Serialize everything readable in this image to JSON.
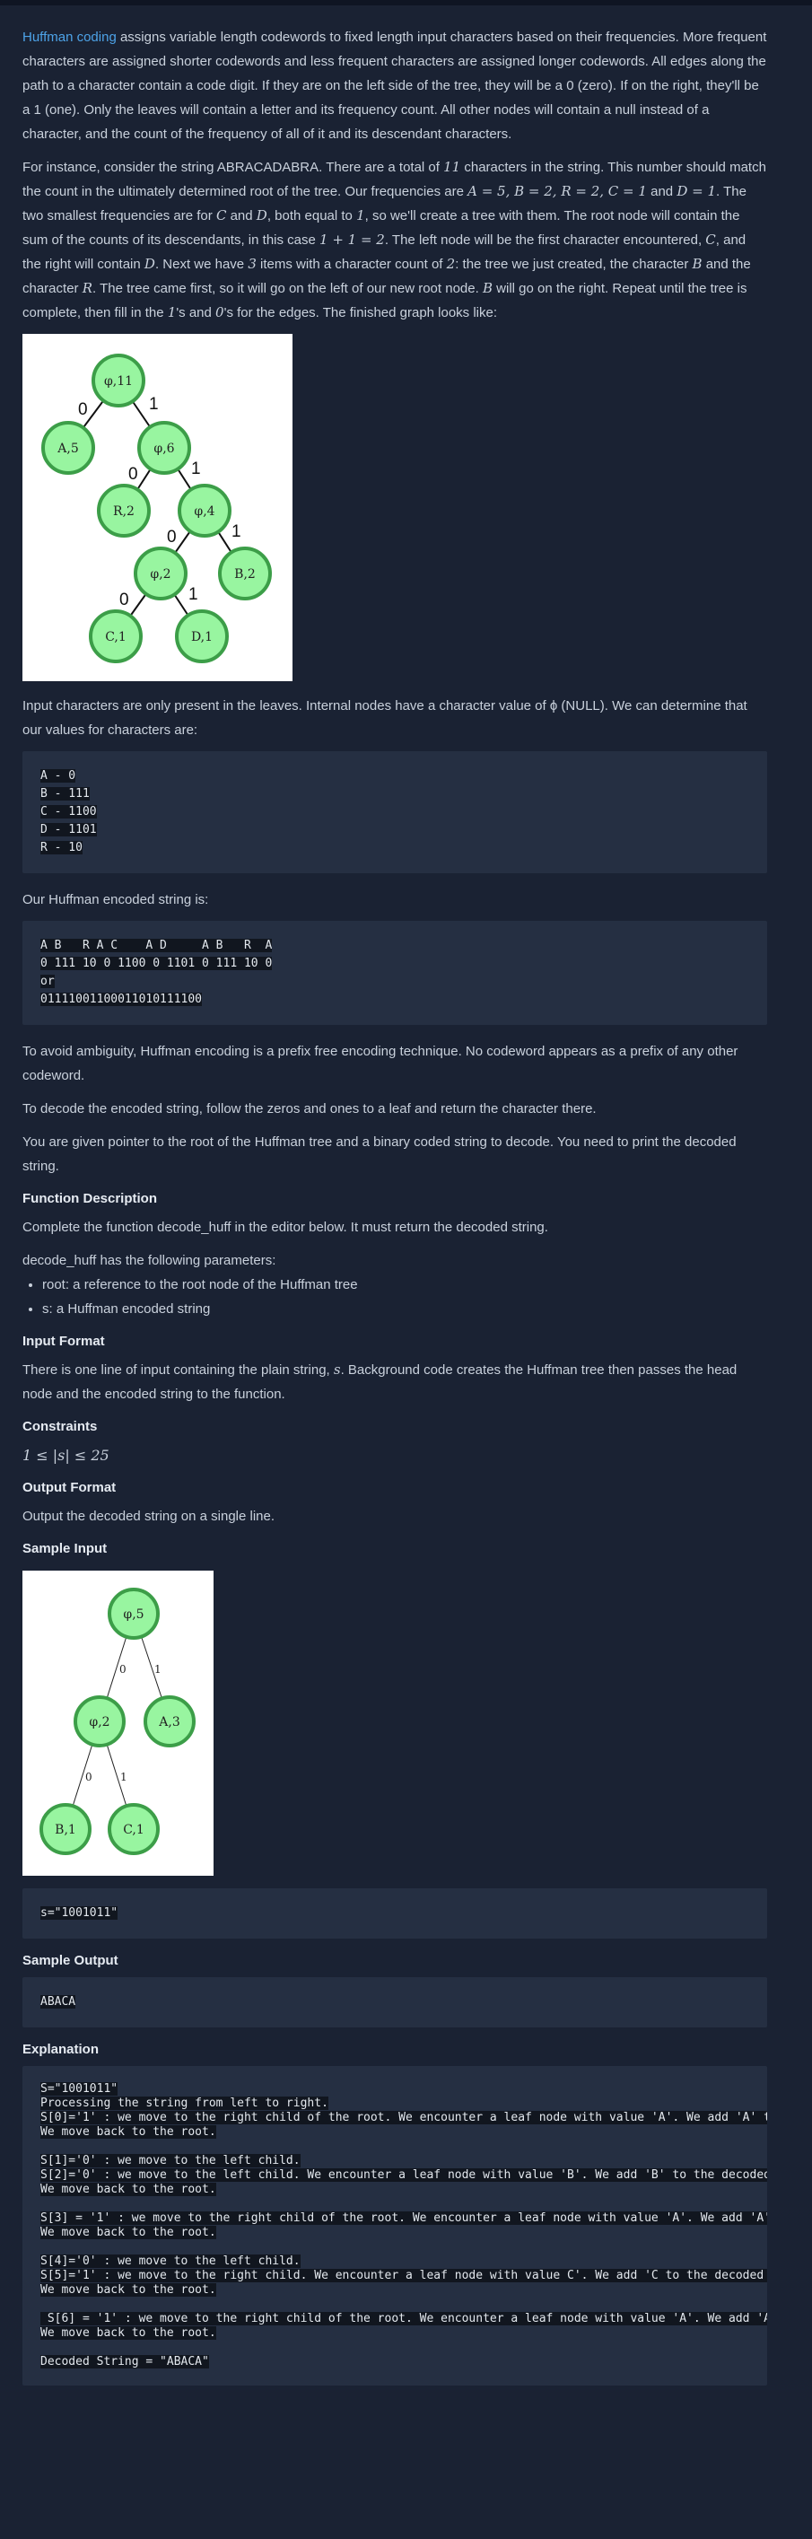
{
  "intro": {
    "link_text": "Huffman coding",
    "p1_rest": " assigns variable length codewords to fixed length input characters based on their frequencies. More frequent characters are assigned shorter codewords and less frequent characters are assigned longer codewords. All edges along the path to a character contain a code digit. If they are on the left side of the tree, they will be a 0 (zero). If on the right, they'll be a 1 (one). Only the leaves will contain a letter and its frequency count. All other nodes will contain a null instead of a character, and the count of the frequency of all of it and its descendant characters.",
    "p2_a": "For instance, consider the string ABRACADABRA. There are a total of ",
    "p2_n11": "11",
    "p2_b": " characters in the string. This number should match the count in the ultimately determined root of the tree. Our frequencies are ",
    "p2_freqs": "A = 5, B = 2, R = 2, C = 1",
    "p2_and": " and ",
    "p2_d1": "D = 1",
    "p2_c": ". The two smallest frequencies are for ",
    "p2_C": "C",
    "p2_and2": " and ",
    "p2_D": "D",
    "p2_d": ", both equal to ",
    "p2_one": "1",
    "p2_e": ", so we'll create a tree with them. The root node will contain the sum of the counts of its descendants, in this case ",
    "p2_sum": "1 + 1 = 2",
    "p2_f": ". The left node will be the first character encountered, ",
    "p2_C2": "C",
    "p2_g": ", and the right will contain ",
    "p2_D2": "D",
    "p2_h": ". Next we have ",
    "p2_3": "3",
    "p2_i": " items with a character count of ",
    "p2_2": "2",
    "p2_j": ": the tree we just created, the character ",
    "p2_B": "B",
    "p2_k": " and the character ",
    "p2_R": "R",
    "p2_l": ". The tree came first, so it will go on the left of our new root node. ",
    "p2_B2": "B",
    "p2_m": " will go on the right. Repeat until the tree is complete, then fill in the ",
    "p2_1s": "1",
    "p2_n": "'s and ",
    "p2_0s": "0",
    "p2_o": "'s for the edges. The finished graph looks like:"
  },
  "tree1": {
    "nodes": [
      "φ,11",
      "A,5",
      "φ,6",
      "R,2",
      "φ,4",
      "φ,2",
      "B,2",
      "C,1",
      "D,1"
    ],
    "edges": [
      "0",
      "1",
      "0",
      "1",
      "0",
      "1",
      "0",
      "1"
    ]
  },
  "after_tree": "Input characters are only present in the leaves. Internal nodes have a character value of ϕ (NULL). We can determine that our values for characters are:",
  "codes_block": "A - 0\nB - 111\nC - 1100\nD - 1101\nR - 10",
  "encoded_label": "Our Huffman encoded string is:",
  "encoded_block": "A B   R A C    A D     A B   R  A\n0 111 10 0 1100 0 1101 0 111 10 0\nor\n01111001100011010111100",
  "p_ambiguity": "To avoid ambiguity, Huffman encoding is a prefix free encoding technique. No codeword appears as a prefix of any other codeword.",
  "p_decode": "To decode the encoded string, follow the zeros and ones to a leaf and return the character there.",
  "p_task": "You are given pointer to the root of the Huffman tree and a binary coded string to decode. You need to print the decoded string.",
  "function_description": {
    "heading": "Function Description",
    "text": "Complete the function decode_huff in the editor below. It must return the decoded string.",
    "params_label": "decode_huff has the following parameters:",
    "params": [
      "root: a reference to the root node of the Huffman tree",
      "s: a Huffman encoded string"
    ]
  },
  "input_format": {
    "heading": "Input Format",
    "text_a": "There is one line of input containing the plain string, ",
    "text_s": "s",
    "text_b": ". Background code creates the Huffman tree then passes the head node and the encoded string to the function."
  },
  "constraints": {
    "heading": "Constraints",
    "text": "1 ≤ |s| ≤ 25"
  },
  "output_format": {
    "heading": "Output Format",
    "text": "Output the decoded string on a single line."
  },
  "sample_input": {
    "heading": "Sample Input",
    "tree_nodes": [
      "φ,5",
      "φ,2",
      "A,3",
      "B,1",
      "C,1"
    ],
    "tree_edges": [
      "0",
      "1",
      "0",
      "1"
    ],
    "code": "s=\"1001011\""
  },
  "sample_output": {
    "heading": "Sample Output",
    "code": "ABACA"
  },
  "explanation": {
    "heading": "Explanation",
    "code": "S=\"1001011\"\nProcessing the string from left to right.\nS[0]='1' : we move to the right child of the root. We encounter a leaf node with value 'A'. We add 'A' to the decoded string.\nWe move back to the root.\n\nS[1]='0' : we move to the left child.\nS[2]='0' : we move to the left child. We encounter a leaf node with value 'B'. We add 'B' to the decoded string.\nWe move back to the root.\n\nS[3] = '1' : we move to the right child of the root. We encounter a leaf node with value 'A'. We add 'A' to the decoded string.\nWe move back to the root.\n\nS[4]='0' : we move to the left child.\nS[5]='1' : we move to the right child. We encounter a leaf node with value C'. We add 'C to the decoded string.\nWe move back to the root.\n\n S[6] = '1' : we move to the right child of the root. We encounter a leaf node with value 'A'. We add 'A' to the decoded string.\nWe move back to the root.\n\nDecoded String = \"ABACA\""
  }
}
